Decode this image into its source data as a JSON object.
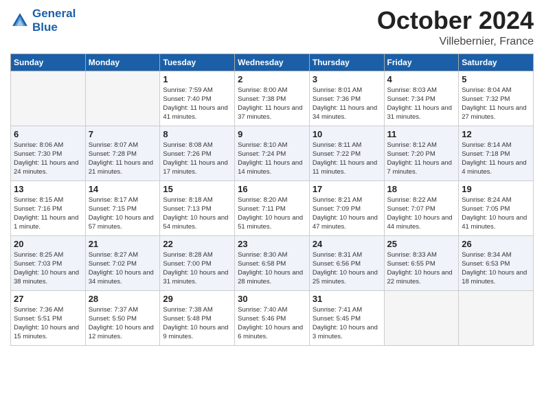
{
  "header": {
    "logo_line1": "General",
    "logo_line2": "Blue",
    "month": "October 2024",
    "location": "Villebernier, France"
  },
  "weekdays": [
    "Sunday",
    "Monday",
    "Tuesday",
    "Wednesday",
    "Thursday",
    "Friday",
    "Saturday"
  ],
  "weeks": [
    [
      {
        "day": "",
        "empty": true
      },
      {
        "day": "",
        "empty": true
      },
      {
        "day": "1",
        "sunrise": "Sunrise: 7:59 AM",
        "sunset": "Sunset: 7:40 PM",
        "daylight": "Daylight: 11 hours and 41 minutes."
      },
      {
        "day": "2",
        "sunrise": "Sunrise: 8:00 AM",
        "sunset": "Sunset: 7:38 PM",
        "daylight": "Daylight: 11 hours and 37 minutes."
      },
      {
        "day": "3",
        "sunrise": "Sunrise: 8:01 AM",
        "sunset": "Sunset: 7:36 PM",
        "daylight": "Daylight: 11 hours and 34 minutes."
      },
      {
        "day": "4",
        "sunrise": "Sunrise: 8:03 AM",
        "sunset": "Sunset: 7:34 PM",
        "daylight": "Daylight: 11 hours and 31 minutes."
      },
      {
        "day": "5",
        "sunrise": "Sunrise: 8:04 AM",
        "sunset": "Sunset: 7:32 PM",
        "daylight": "Daylight: 11 hours and 27 minutes."
      }
    ],
    [
      {
        "day": "6",
        "sunrise": "Sunrise: 8:06 AM",
        "sunset": "Sunset: 7:30 PM",
        "daylight": "Daylight: 11 hours and 24 minutes."
      },
      {
        "day": "7",
        "sunrise": "Sunrise: 8:07 AM",
        "sunset": "Sunset: 7:28 PM",
        "daylight": "Daylight: 11 hours and 21 minutes."
      },
      {
        "day": "8",
        "sunrise": "Sunrise: 8:08 AM",
        "sunset": "Sunset: 7:26 PM",
        "daylight": "Daylight: 11 hours and 17 minutes."
      },
      {
        "day": "9",
        "sunrise": "Sunrise: 8:10 AM",
        "sunset": "Sunset: 7:24 PM",
        "daylight": "Daylight: 11 hours and 14 minutes."
      },
      {
        "day": "10",
        "sunrise": "Sunrise: 8:11 AM",
        "sunset": "Sunset: 7:22 PM",
        "daylight": "Daylight: 11 hours and 11 minutes."
      },
      {
        "day": "11",
        "sunrise": "Sunrise: 8:12 AM",
        "sunset": "Sunset: 7:20 PM",
        "daylight": "Daylight: 11 hours and 7 minutes."
      },
      {
        "day": "12",
        "sunrise": "Sunrise: 8:14 AM",
        "sunset": "Sunset: 7:18 PM",
        "daylight": "Daylight: 11 hours and 4 minutes."
      }
    ],
    [
      {
        "day": "13",
        "sunrise": "Sunrise: 8:15 AM",
        "sunset": "Sunset: 7:16 PM",
        "daylight": "Daylight: 11 hours and 1 minute."
      },
      {
        "day": "14",
        "sunrise": "Sunrise: 8:17 AM",
        "sunset": "Sunset: 7:15 PM",
        "daylight": "Daylight: 10 hours and 57 minutes."
      },
      {
        "day": "15",
        "sunrise": "Sunrise: 8:18 AM",
        "sunset": "Sunset: 7:13 PM",
        "daylight": "Daylight: 10 hours and 54 minutes."
      },
      {
        "day": "16",
        "sunrise": "Sunrise: 8:20 AM",
        "sunset": "Sunset: 7:11 PM",
        "daylight": "Daylight: 10 hours and 51 minutes."
      },
      {
        "day": "17",
        "sunrise": "Sunrise: 8:21 AM",
        "sunset": "Sunset: 7:09 PM",
        "daylight": "Daylight: 10 hours and 47 minutes."
      },
      {
        "day": "18",
        "sunrise": "Sunrise: 8:22 AM",
        "sunset": "Sunset: 7:07 PM",
        "daylight": "Daylight: 10 hours and 44 minutes."
      },
      {
        "day": "19",
        "sunrise": "Sunrise: 8:24 AM",
        "sunset": "Sunset: 7:05 PM",
        "daylight": "Daylight: 10 hours and 41 minutes."
      }
    ],
    [
      {
        "day": "20",
        "sunrise": "Sunrise: 8:25 AM",
        "sunset": "Sunset: 7:03 PM",
        "daylight": "Daylight: 10 hours and 38 minutes."
      },
      {
        "day": "21",
        "sunrise": "Sunrise: 8:27 AM",
        "sunset": "Sunset: 7:02 PM",
        "daylight": "Daylight: 10 hours and 34 minutes."
      },
      {
        "day": "22",
        "sunrise": "Sunrise: 8:28 AM",
        "sunset": "Sunset: 7:00 PM",
        "daylight": "Daylight: 10 hours and 31 minutes."
      },
      {
        "day": "23",
        "sunrise": "Sunrise: 8:30 AM",
        "sunset": "Sunset: 6:58 PM",
        "daylight": "Daylight: 10 hours and 28 minutes."
      },
      {
        "day": "24",
        "sunrise": "Sunrise: 8:31 AM",
        "sunset": "Sunset: 6:56 PM",
        "daylight": "Daylight: 10 hours and 25 minutes."
      },
      {
        "day": "25",
        "sunrise": "Sunrise: 8:33 AM",
        "sunset": "Sunset: 6:55 PM",
        "daylight": "Daylight: 10 hours and 22 minutes."
      },
      {
        "day": "26",
        "sunrise": "Sunrise: 8:34 AM",
        "sunset": "Sunset: 6:53 PM",
        "daylight": "Daylight: 10 hours and 18 minutes."
      }
    ],
    [
      {
        "day": "27",
        "sunrise": "Sunrise: 7:36 AM",
        "sunset": "Sunset: 5:51 PM",
        "daylight": "Daylight: 10 hours and 15 minutes."
      },
      {
        "day": "28",
        "sunrise": "Sunrise: 7:37 AM",
        "sunset": "Sunset: 5:50 PM",
        "daylight": "Daylight: 10 hours and 12 minutes."
      },
      {
        "day": "29",
        "sunrise": "Sunrise: 7:38 AM",
        "sunset": "Sunset: 5:48 PM",
        "daylight": "Daylight: 10 hours and 9 minutes."
      },
      {
        "day": "30",
        "sunrise": "Sunrise: 7:40 AM",
        "sunset": "Sunset: 5:46 PM",
        "daylight": "Daylight: 10 hours and 6 minutes."
      },
      {
        "day": "31",
        "sunrise": "Sunrise: 7:41 AM",
        "sunset": "Sunset: 5:45 PM",
        "daylight": "Daylight: 10 hours and 3 minutes."
      },
      {
        "day": "",
        "empty": true
      },
      {
        "day": "",
        "empty": true
      }
    ]
  ]
}
